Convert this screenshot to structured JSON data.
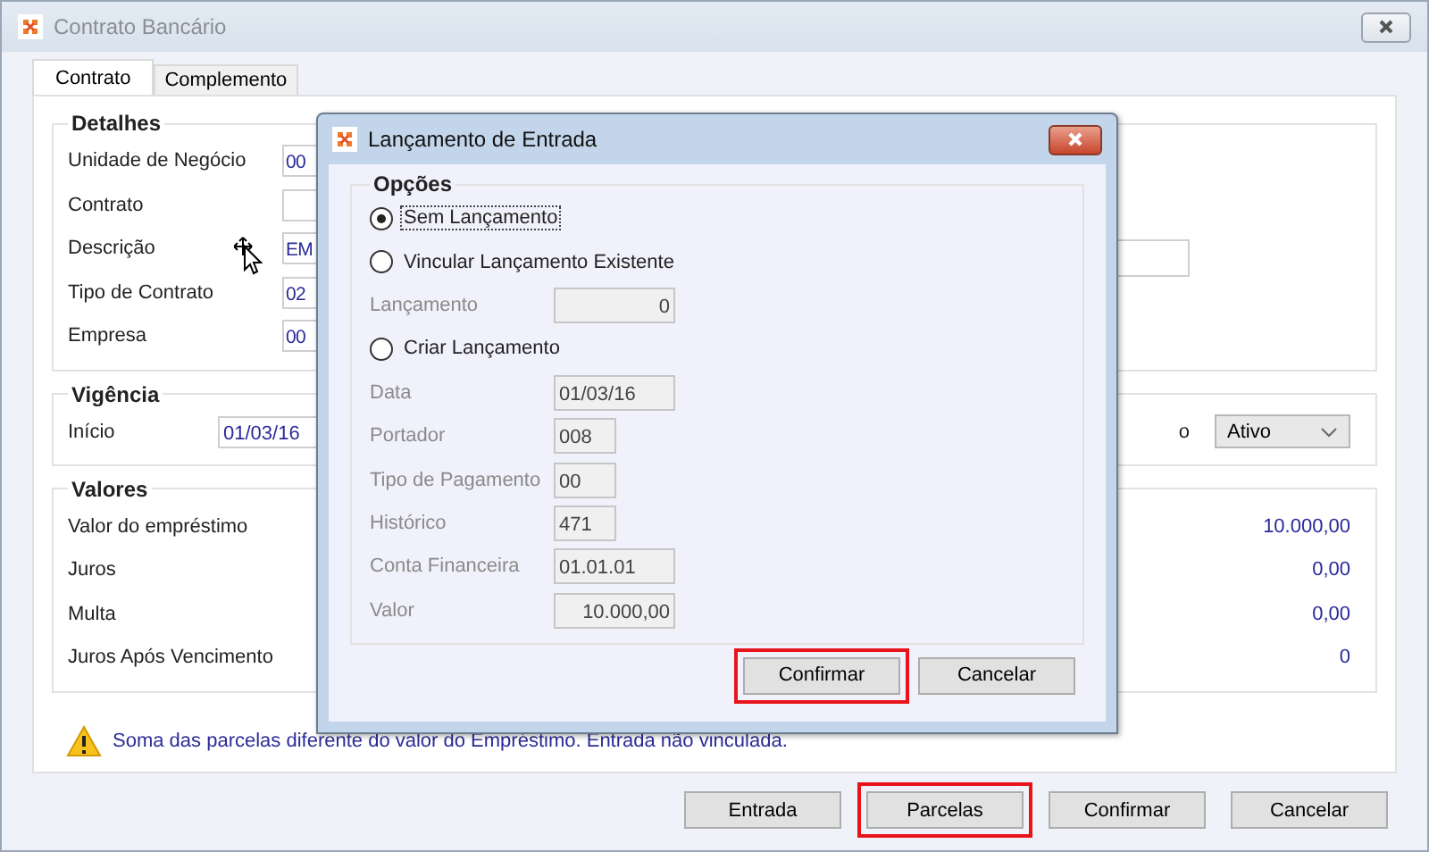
{
  "window": {
    "title": "Contrato Bancário"
  },
  "tabs": [
    {
      "label": "Contrato",
      "selected": true
    },
    {
      "label": "Complemento",
      "selected": false
    }
  ],
  "detalhes": {
    "title": "Detalhes",
    "fields": [
      {
        "label": "Unidade de Negócio",
        "value": "00"
      },
      {
        "label": "Contrato"
      },
      {
        "label": "Descrição",
        "value": "EM"
      },
      {
        "label": "Tipo de Contrato",
        "value": "02"
      },
      {
        "label": "Empresa",
        "value": "00"
      }
    ]
  },
  "vigencia": {
    "title": "Vigência",
    "start_label": "Início",
    "start_value": "01/03/16",
    "status_label": "o",
    "status": "Ativo"
  },
  "valores": {
    "title": "Valores",
    "rows": [
      {
        "label": "Valor do empréstimo",
        "value": "10.000,00"
      },
      {
        "label": "Juros",
        "value": "0,00"
      },
      {
        "label": "Multa",
        "value": "0,00"
      },
      {
        "label": "Juros Após Vencimento",
        "value": "0"
      }
    ]
  },
  "warning": "Soma das parcelas diferente do valor do Empréstimo. Entrada não vinculada.",
  "buttons": [
    {
      "label": "Entrada",
      "highlighted": false
    },
    {
      "label": "Parcelas",
      "highlighted": true
    },
    {
      "label": "Confirmar",
      "highlighted": false
    },
    {
      "label": "Cancelar",
      "highlighted": false
    }
  ],
  "dialog": {
    "title": "Lançamento de Entrada",
    "group_title": "Opções",
    "items": [
      {
        "kind": "radio",
        "label": "Sem Lançamento",
        "selected": true,
        "focused": true
      },
      {
        "kind": "radio",
        "label": "Vincular Lançamento Existente",
        "selected": false,
        "focused": false
      },
      {
        "kind": "amount",
        "label": "Lançamento",
        "value": "0",
        "disabled": true
      },
      {
        "kind": "radio",
        "label": "Criar Lançamento",
        "selected": false,
        "focused": false
      },
      {
        "kind": "field",
        "label": "Data",
        "value": "01/03/16",
        "disabled": true
      },
      {
        "kind": "field",
        "label": "Portador",
        "value": "008",
        "disabled": true
      },
      {
        "kind": "field",
        "label": "Tipo de Pagamento",
        "value": "00",
        "disabled": true
      },
      {
        "kind": "field",
        "label": "Histórico",
        "value": "471",
        "disabled": true
      },
      {
        "kind": "field",
        "label": "Conta Financeira",
        "value": "01.01.01",
        "disabled": true
      },
      {
        "kind": "amount",
        "label": "Valor",
        "value": "10.000,00",
        "disabled": true
      }
    ],
    "buttons": [
      {
        "label": "Confirmar",
        "highlighted": true
      },
      {
        "label": "Cancelar",
        "highlighted": false
      }
    ]
  }
}
